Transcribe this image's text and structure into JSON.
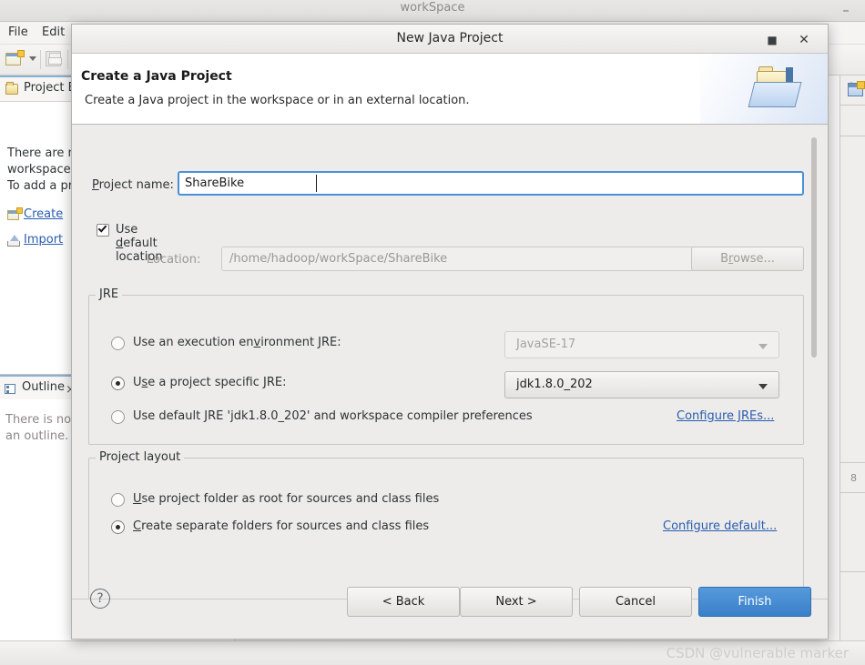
{
  "background": {
    "window_title": "workSpace",
    "minimize_label": "–",
    "menus": [
      "File",
      "Edit"
    ],
    "toolbar": {
      "new_icon": "new-file-icon",
      "dropdown_icon": "chevron-down-icon",
      "save_icon": "save-icon"
    },
    "project_explorer": {
      "tab_label": "Project Exp",
      "empty_text": "There are no\nworkspace.\nTo add a pro",
      "links": [
        "Create",
        "Import"
      ]
    },
    "outline": {
      "tab_label": "Outline",
      "close_label": "×",
      "empty_text": "There is no a\nan outline."
    },
    "perspective_icon": "perspective-java-icon",
    "watermark": "CSDN @vulnerable marker"
  },
  "dialog": {
    "title": "New Java Project",
    "maximize_label": "■",
    "close_label": "✕",
    "header": {
      "title": "Create a Java Project",
      "description": "Create a Java project in the workspace or in an external location.",
      "icon": "java-project-folder-icon"
    },
    "form": {
      "project_name_label": "Project name:",
      "project_name_value": "ShareBike",
      "use_default_location_label": "Use default location",
      "use_default_location_checked": true,
      "location_label": "Location:",
      "location_value": "/home/hadoop/workSpace/ShareBike",
      "browse_label": "Browse..."
    },
    "jre_group": {
      "legend": "JRE",
      "options": [
        {
          "label": "Use an execution environment JRE:",
          "selected": false,
          "combo_value": "JavaSE-17",
          "combo_enabled": false
        },
        {
          "label": "Use a project specific JRE:",
          "selected": true,
          "combo_value": "jdk1.8.0_202",
          "combo_enabled": true
        },
        {
          "label": "Use default JRE 'jdk1.8.0_202' and workspace compiler preferences",
          "selected": false
        }
      ],
      "configure_link": "Configure JREs..."
    },
    "layout_group": {
      "legend": "Project layout",
      "options": [
        {
          "label": "Use project folder as root for sources and class files",
          "selected": false
        },
        {
          "label": "Create separate folders for sources and class files",
          "selected": true
        }
      ],
      "configure_link": "Configure default..."
    },
    "footer": {
      "help_label": "?",
      "back_label": "< Back",
      "next_label": "Next >",
      "cancel_label": "Cancel",
      "finish_label": "Finish"
    }
  },
  "colors": {
    "accent_blue": "#4a90d9",
    "primary_button": "#3a80c8",
    "link": "#2a5db0",
    "dialog_bg": "#edecea"
  }
}
